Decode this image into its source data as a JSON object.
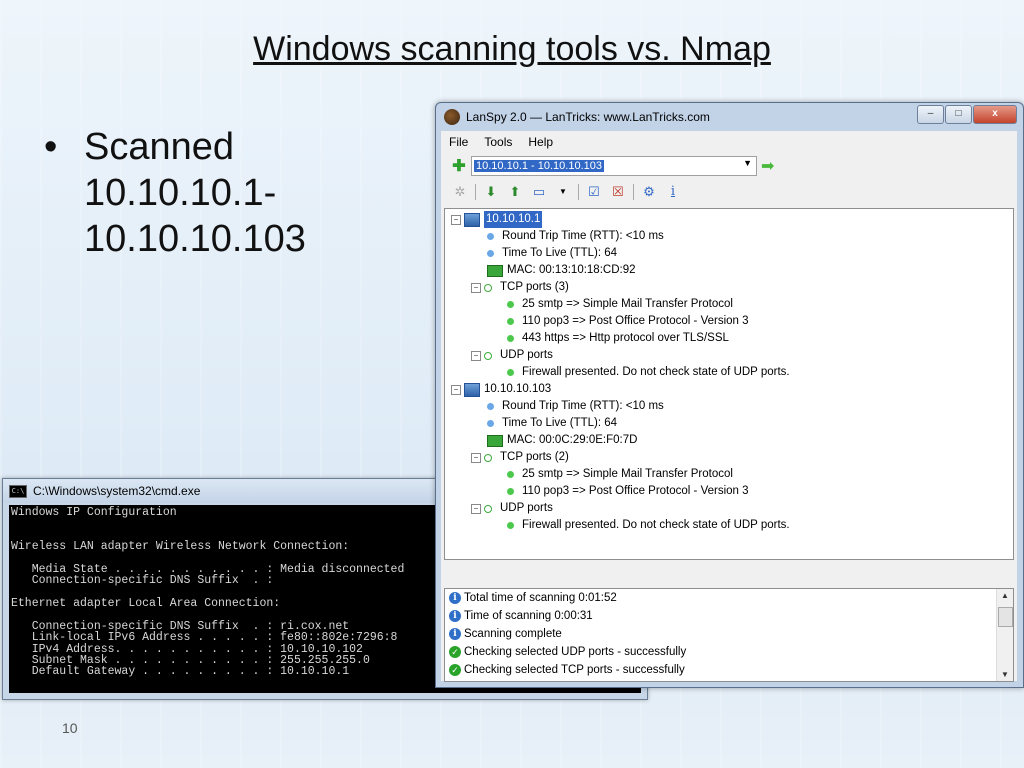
{
  "slide": {
    "title": "Windows scanning tools vs. Nmap",
    "bullet_dot": "•",
    "bullet_lines": [
      "Scanned",
      "10.10.10.1-",
      "10.10.10.103"
    ],
    "page_number": "10"
  },
  "cmd": {
    "title": "C:\\Windows\\system32\\cmd.exe",
    "icon_text": "C:\\",
    "lines": [
      "Windows IP Configuration",
      "",
      "",
      "Wireless LAN adapter Wireless Network Connection:",
      "",
      "   Media State . . . . . . . . . . . : Media disconnected",
      "   Connection-specific DNS Suffix  . :",
      "",
      "Ethernet adapter Local Area Connection:",
      "",
      "   Connection-specific DNS Suffix  . : ri.cox.net",
      "   Link-local IPv6 Address . . . . . : fe80::802e:7296:8",
      "   IPv4 Address. . . . . . . . . . . : 10.10.10.102",
      "   Subnet Mask . . . . . . . . . . . : 255.255.255.0",
      "   Default Gateway . . . . . . . . . : 10.10.10.1"
    ]
  },
  "lanspy": {
    "title": "LanSpy 2.0 — LanTricks: www.LanTricks.com",
    "window_controls": {
      "minimize": "–",
      "maximize": "□",
      "close": "x"
    },
    "menu": [
      "File",
      "Tools",
      "Help"
    ],
    "address_value": "10.10.10.1 - 10.10.10.103",
    "tree": {
      "hosts": [
        {
          "ip": "10.10.10.1",
          "rtt": "Round Trip Time (RTT): <10 ms",
          "ttl": "Time To Live (TTL): 64",
          "mac": "MAC: 00:13:10:18:CD:92",
          "tcp_label": "TCP ports (3)",
          "tcp": [
            "25 smtp => Simple Mail Transfer Protocol",
            "110 pop3 => Post Office Protocol - Version 3",
            "443 https => Http protocol over TLS/SSL"
          ],
          "udp_label": "UDP ports",
          "udp": [
            "Firewall presented. Do not check state of UDP ports."
          ]
        },
        {
          "ip": "10.10.10.103",
          "rtt": "Round Trip Time (RTT): <10 ms",
          "ttl": "Time To Live (TTL): 64",
          "mac": "MAC: 00:0C:29:0E:F0:7D",
          "tcp_label": "TCP ports (2)",
          "tcp": [
            "25 smtp => Simple Mail Transfer Protocol",
            "110 pop3 => Post Office Protocol - Version 3"
          ],
          "udp_label": "UDP ports",
          "udp": [
            "Firewall presented. Do not check state of UDP ports."
          ]
        }
      ]
    },
    "log": [
      {
        "icon": "info-icon",
        "text": "Total time of scanning 0:01:52"
      },
      {
        "icon": "info-icon",
        "text": "Time of scanning 0:00:31"
      },
      {
        "icon": "info-icon",
        "text": "Scanning complete"
      },
      {
        "icon": "check-icon",
        "text": "Checking selected UDP ports - successfully"
      },
      {
        "icon": "check-icon",
        "text": "Checking selected TCP ports - successfully"
      }
    ]
  }
}
